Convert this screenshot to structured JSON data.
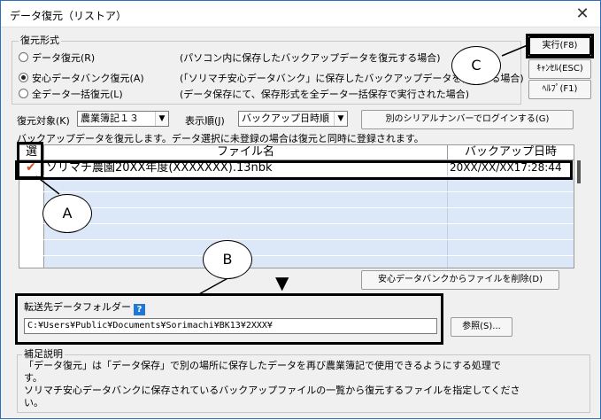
{
  "window": {
    "title": "データ復元（リストア）",
    "close_glyph": "✕"
  },
  "restore_type": {
    "legend": "復元形式",
    "options": [
      {
        "label": "データ復元(R)",
        "desc": "(パソコン内に保存したバックアップデータを復元する場合)",
        "selected": false
      },
      {
        "label": "安心データバンク復元(A)",
        "desc": "(「ソリマチ安心データバンク」に保存したバックアップデータを復元する場合)",
        "selected": true
      },
      {
        "label": "全データ一括復元(L)",
        "desc": "(データ保存にて、保存形式を全データ一括保存で実行された場合)",
        "selected": false
      }
    ]
  },
  "buttons": {
    "execute": "実行(F8)",
    "cancel": "ｷｬﾝｾﾙ(ESC)",
    "help": "ﾍﾙﾌﾟ(F1)",
    "login_other": "別のシリアルナンバーでログインする(G)",
    "delete_file": "安心データバンクからファイルを削除(D)",
    "browse": "参照(S)..."
  },
  "filters": {
    "target_label": "復元対象(K)",
    "target_value": "農業簿記１３",
    "order_label": "表示順(J)",
    "order_value": "バックアップ日時順"
  },
  "info_text": "バックアップデータを復元します。データ選択に未登録の場合は復元と同時に登録されます。",
  "table": {
    "headers": {
      "select": "選",
      "filename": "ファイル名",
      "datetime": "バックアップ日時"
    },
    "rows": [
      {
        "check": "✔",
        "filename": "ソリマチ農園20XX年度(XXXXXXX).13nbk",
        "datetime": "20XX/XX/XX17:28:44"
      }
    ]
  },
  "destination": {
    "label": "転送先データフォルダー",
    "help_glyph": "?",
    "path": "C:¥Users¥Public¥Documents¥Sorimachi¥BK13¥2XXX¥"
  },
  "notes": {
    "legend": "補足説明",
    "lines": [
      "「データ復元」は「データ保存」で別の場所に保存したデータを再び農業簿記で使用できるようにする処理で",
      "す。",
      "ソリマチ安心データバンクに保存されているバックアップファイルの一覧から復元するファイルを指定してくださ",
      "い。"
    ]
  },
  "callouts": {
    "a": "A",
    "b": "B",
    "c": "C",
    "arrow_glyph": "▼"
  },
  "colors": {
    "selected_row_bg": "#dce8f7",
    "check": "#d24a1a",
    "help_icon": "#1f78d1",
    "window_border": "#2b6fc0"
  }
}
